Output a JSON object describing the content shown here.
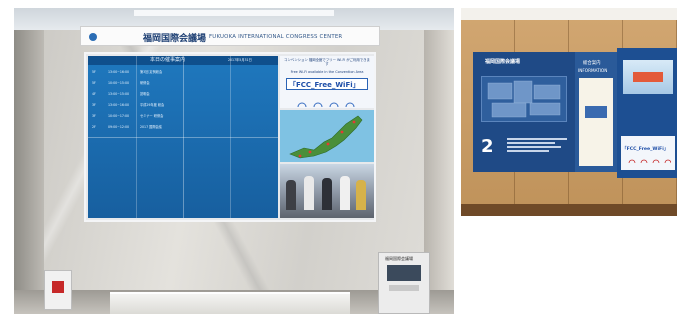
{
  "photo1": {
    "venue_japanese": "福岡国際会議場",
    "venue_english": "FUKUOKA INTERNATIONAL CONGRESS CENTER",
    "board_title": "本日の催事案内",
    "board_date": "2017年5月31日",
    "events": [
      {
        "floor": "5F",
        "time": "13:00~16:00",
        "name": "第3回 定例総会"
      },
      {
        "floor": "5F",
        "time": "10:00~15:00",
        "name": "研修会"
      },
      {
        "floor": "4F",
        "time": "13:00~15:00",
        "name": "説明会"
      },
      {
        "floor": "3F",
        "time": "13:00~16:00",
        "name": "平成29年度 総会"
      },
      {
        "floor": "3F",
        "time": "10:00~17:00",
        "name": "セミナー 研修会"
      },
      {
        "floor": "2F",
        "time": "09:00~12:00",
        "name": "2017 国際会議"
      }
    ],
    "wifi_notice_japanese": "コンベンション 福岡全館でフリー Wi-Fi がご利用できます",
    "wifi_notice_english": "Free Wi-Fi available in the Convention Area",
    "wifi_ssid": "「FCC_Free_WiFi」",
    "kiosk_label": "福岡国際会議場"
  },
  "photo2": {
    "venue_japanese": "福岡国際会議場",
    "info_japanese": "総合案内",
    "info_english": "INFORMATION",
    "floor_number": "2",
    "wifi_ssid": "「FCC_Free_WiFi」"
  },
  "colors": {
    "board_blue": "#1b6fb3",
    "wood": "#c59a63",
    "navy_panel": "#1f4a86"
  }
}
